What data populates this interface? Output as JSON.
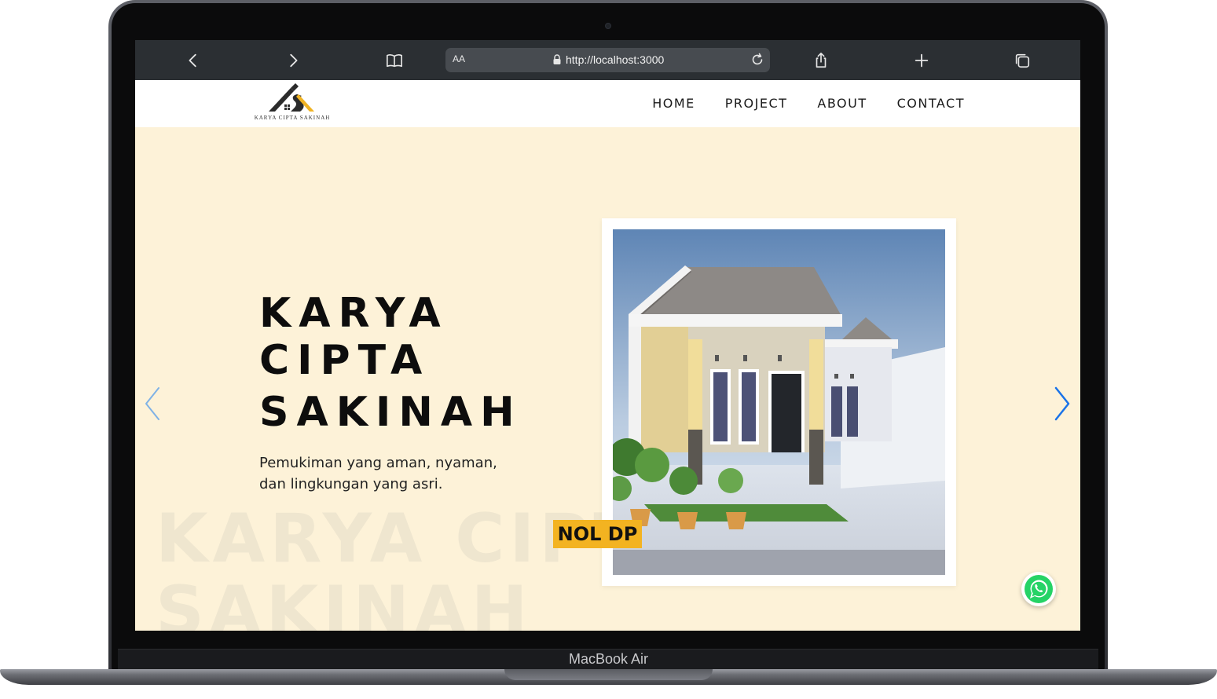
{
  "device": {
    "model_label": "MacBook Air"
  },
  "browser": {
    "text_size_label": "AA",
    "url": "http://localhost:3000",
    "icons": [
      "back-icon",
      "forward-icon",
      "bookmarks-icon",
      "lock-icon",
      "reload-icon",
      "share-icon",
      "new-tab-icon",
      "tabs-icon"
    ]
  },
  "site": {
    "logo_text": "KARYA CIPTA SAKINAH",
    "nav": [
      {
        "label": "HOME"
      },
      {
        "label": "PROJECT"
      },
      {
        "label": "ABOUT"
      },
      {
        "label": "CONTACT"
      }
    ],
    "hero": {
      "title_lines": [
        "KARYA",
        "CIPTA",
        "SAKINAH"
      ],
      "subtitle_line1": "Pemukiman yang aman, nyaman,",
      "subtitle_line2": "dan lingkungan yang asri.",
      "badge": "NOL DP",
      "watermark_line1": "KARYA CIPTA",
      "watermark_line2": "SAKINAH"
    },
    "colors": {
      "hero_bg": "#fdf2d8",
      "badge_bg": "#f3b321",
      "carousel_arrow": "#1a73e8",
      "whatsapp": "#25d366"
    }
  }
}
